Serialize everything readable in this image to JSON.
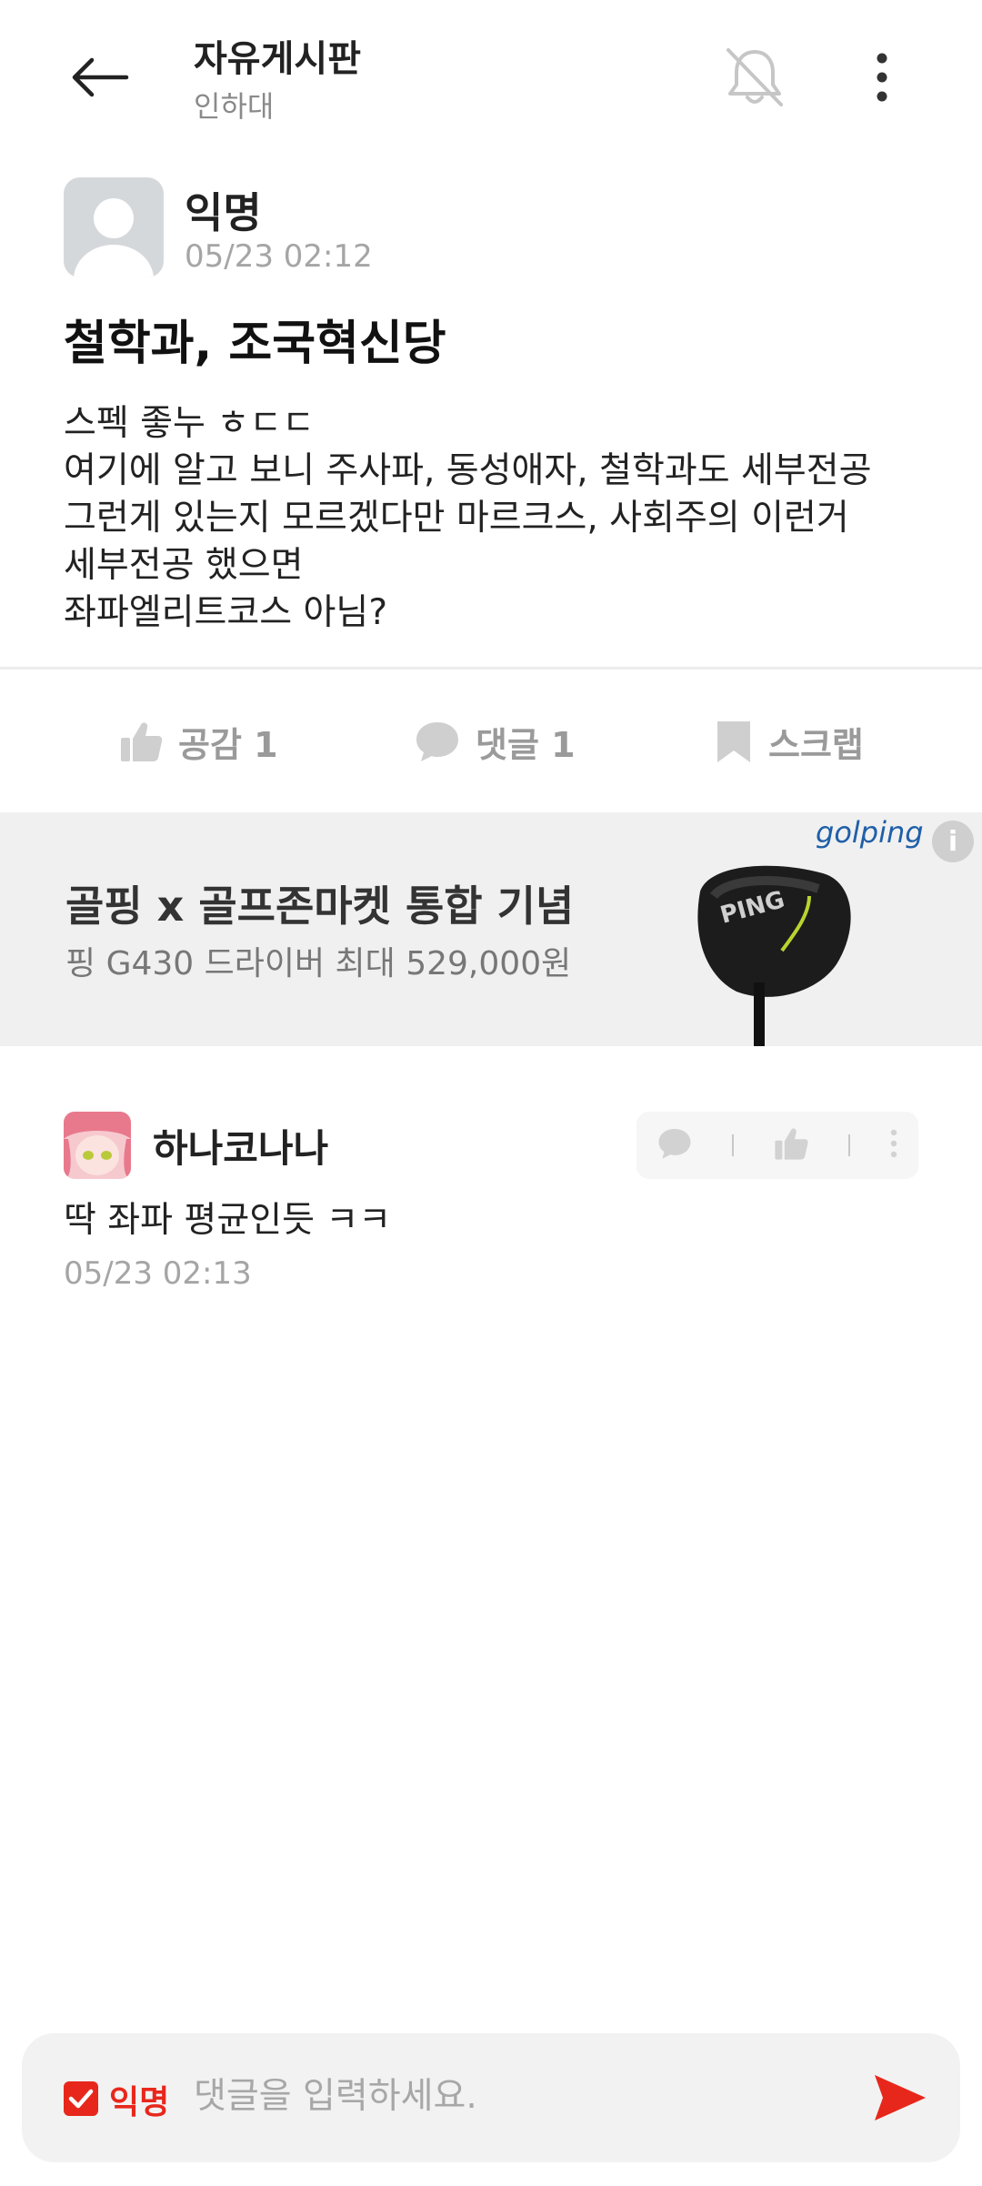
{
  "header": {
    "title": "자유게시판",
    "subtitle": "인하대",
    "back_icon": "back-arrow-icon",
    "bell_icon": "bell-off-icon",
    "more_icon": "more-vertical-icon"
  },
  "post": {
    "author": "익명",
    "time": "05/23 02:12",
    "title": "철학과, 조국혁신당",
    "body_lines": [
      "스펙 좋누 ㅎㄷㄷ",
      "여기에 알고 보니 주사파, 동성애자, 철학과도 세부전공",
      "그런게 있는지 모르겠다만 마르크스, 사회주의 이런거",
      "세부전공 했으면",
      "좌파엘리트코스 아님?"
    ]
  },
  "actions": {
    "like_label": "공감 1",
    "comment_label": "댓글 1",
    "scrap_label": "스크랩"
  },
  "ad": {
    "brand": "golping",
    "title": "골핑 x 골프존마켓 통합 기념",
    "subtitle": "핑 G430 드라이버 최대 529,000원",
    "product_text": "PING",
    "info_icon": "i"
  },
  "comments": [
    {
      "author": "하나코나나",
      "text": "딱 좌파 평균인듯 ㅋㅋ",
      "time": "05/23 02:13"
    }
  ],
  "input": {
    "anon_label": "익명",
    "anon_checked": true,
    "placeholder": "댓글을 입력하세요."
  },
  "colors": {
    "accent": "#e8271c",
    "muted": "#a5a5a5",
    "ad_bg": "#f0f0f0"
  }
}
